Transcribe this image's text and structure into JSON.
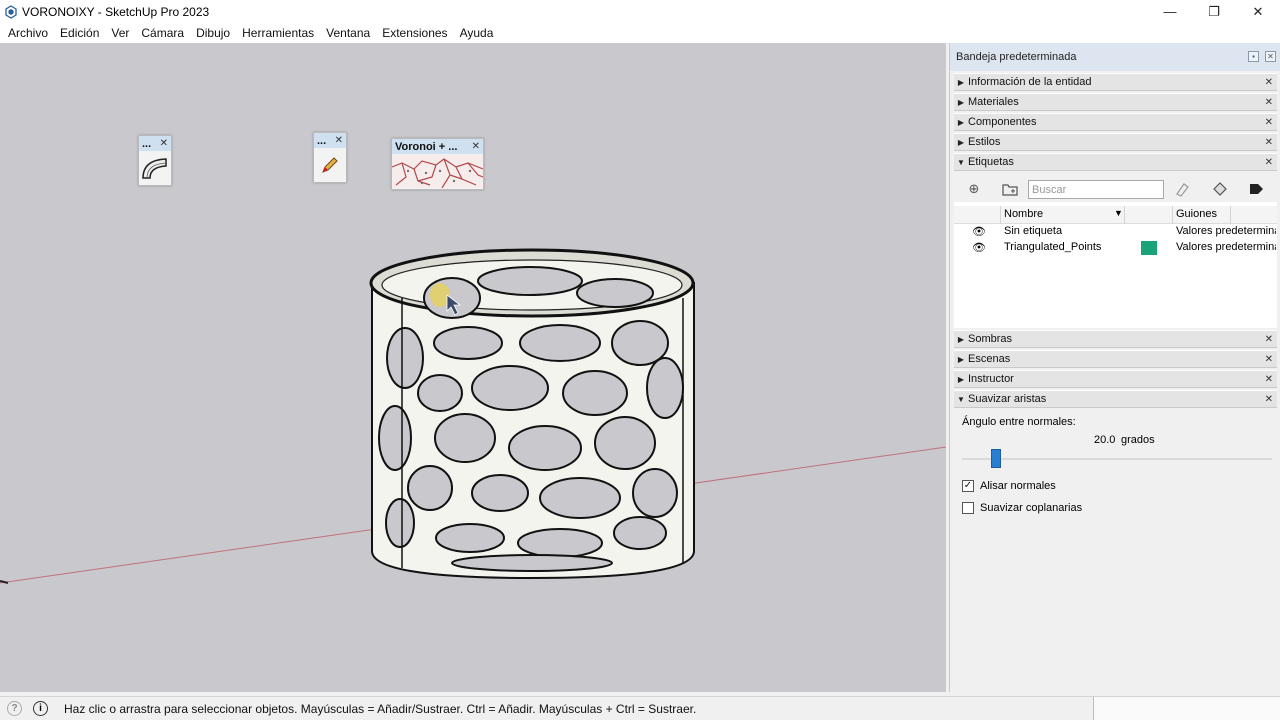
{
  "window": {
    "title": "VORONOIXY - SketchUp Pro 2023",
    "minimize": "—",
    "maximize": "❐",
    "close": "✕"
  },
  "menu": [
    "Archivo",
    "Edición",
    "Ver",
    "Cámara",
    "Dibujo",
    "Herramientas",
    "Ventana",
    "Extensiones",
    "Ayuda"
  ],
  "floating_toolbars": [
    {
      "title": "...",
      "icon": "bend-icon"
    },
    {
      "title": "...",
      "icon": "pencil-icon"
    },
    {
      "title": "Voronoi + ...",
      "icon": "voronoi-icon"
    }
  ],
  "tray": {
    "title": "Bandeja predeterminada",
    "panels_top": [
      {
        "label": "Información de la entidad",
        "expanded": false
      },
      {
        "label": "Materiales",
        "expanded": false
      },
      {
        "label": "Componentes",
        "expanded": false
      },
      {
        "label": "Estilos",
        "expanded": false
      },
      {
        "label": "Etiquetas",
        "expanded": true
      }
    ],
    "tags": {
      "search_placeholder": "Buscar",
      "col_name": "Nombre",
      "col_dashes": "Guiones",
      "rows": [
        {
          "name": "Sin etiqueta",
          "dashes": "Valores predetermina",
          "color": ""
        },
        {
          "name": "Triangulated_Points",
          "dashes": "Valores predetermina",
          "color": "#1aa37a"
        }
      ]
    },
    "panels_bottom": [
      {
        "label": "Sombras",
        "expanded": false
      },
      {
        "label": "Escenas",
        "expanded": false
      },
      {
        "label": "Instructor",
        "expanded": false
      },
      {
        "label": "Suavizar aristas",
        "expanded": true
      }
    ],
    "smooth": {
      "angle_label": "Ángulo entre normales:",
      "angle_value": "20.0",
      "angle_unit": "grados",
      "slider_fraction": 0.11,
      "smooth_normals_label": "Alisar normales",
      "smooth_normals_checked": true,
      "soften_coplanar_label": "Suavizar coplanarias",
      "soften_coplanar_checked": false
    }
  },
  "status": {
    "text": "Haz clic o arrastra para seleccionar objetos. Mayúsculas = Añadir/Sustraer. Ctrl = Añadir. Mayúsculas + Ctrl = Sustraer."
  },
  "colors": {
    "viewport_bg": "#c9c9cd",
    "tray_header": "#dde6f0",
    "slider_thumb": "#2a7ed2",
    "tag_color": "#1aa37a"
  }
}
